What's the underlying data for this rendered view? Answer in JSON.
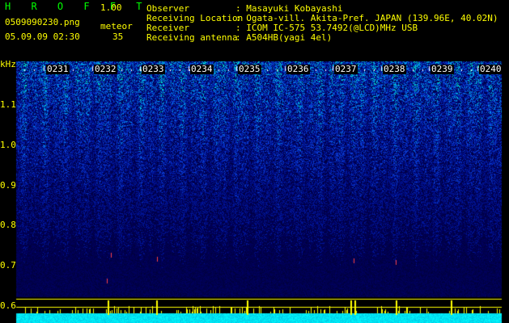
{
  "app": {
    "title": "H R O F F T",
    "version": "1.00"
  },
  "file": {
    "name": "0509090230.png",
    "datetime": "05.09.09 02:30"
  },
  "meteor": {
    "label": "meteor",
    "count": "35"
  },
  "info": [
    {
      "key": "Observer",
      "value": ": Masayuki Kobayashi"
    },
    {
      "key": "Receiving Location",
      "value": ": Ogata-vill. Akita-Pref. JAPAN (139.96E, 40.02N)"
    },
    {
      "key": "Receiver",
      "value": ": ICOM IC-575 53.7492(@LCD)MHz USB"
    },
    {
      "key": "Receiving antenna",
      "value": ": A504HB(yagi 4el)"
    }
  ],
  "yaxis": {
    "unit": "kHz",
    "labels": [
      "1.1",
      "1.0",
      "0.9",
      "0.8",
      "0.7",
      "0.6"
    ]
  },
  "time_ticks": [
    "0231",
    "0232",
    "0233",
    "0234",
    "0235",
    "0236",
    "0237",
    "0238",
    "0239",
    "0240"
  ],
  "colors": {
    "header_text": "#ffff00",
    "title_text": "#00ff00",
    "noise_low": "#00003c",
    "noise_high": "#00ffc8",
    "baseline": "#00ffff",
    "spike": "#ffff00",
    "meteor_echo": "#ff4040"
  }
}
